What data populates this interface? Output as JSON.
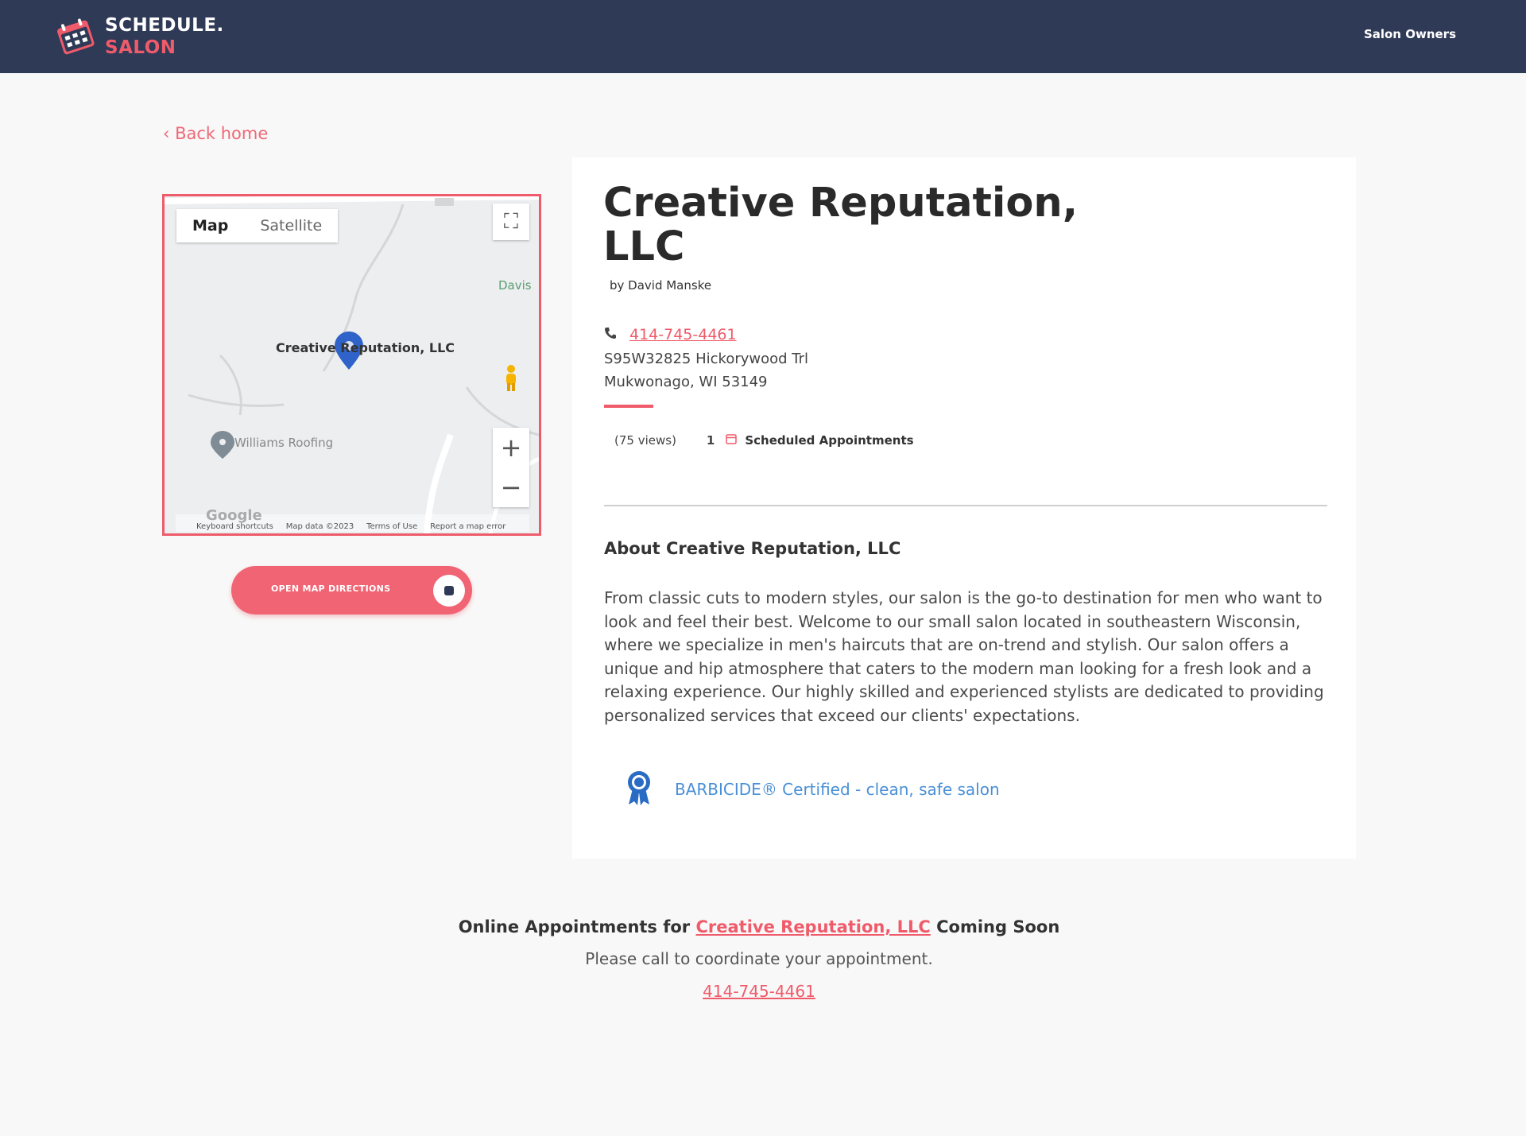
{
  "header": {
    "logo_line1": "SCHEDULE.",
    "logo_line2": "SALON",
    "owners_link": "Salon Owners"
  },
  "nav": {
    "back_link": "‹ Back home"
  },
  "map": {
    "tab_map": "Map",
    "tab_satellite": "Satellite",
    "marker_label": "Creative Reputation, LLC",
    "poi_label": "Williams Roofing",
    "place_label": "Davis",
    "zoom_in": "+",
    "zoom_out": "−",
    "google_label": "Google",
    "footer_shortcuts": "Keyboard shortcuts",
    "footer_data": "Map data ©2023",
    "footer_terms": "Terms of Use",
    "footer_report": "Report a map error"
  },
  "directions_button": {
    "label": "OPEN MAP DIRECTIONS"
  },
  "business": {
    "name": "Creative Reputation, LLC",
    "byline": "by David Manske",
    "phone": "414-745-4461",
    "address_line1": "S95W32825 Hickorywood Trl",
    "address_line2": "Mukwonago, WI 53149",
    "views": "(75 views)",
    "appointments_count": "1",
    "appointments_label": "Scheduled Appointments",
    "about_heading": "About Creative Reputation, LLC",
    "about_text": "From classic cuts to modern styles, our salon is the go-to destination for men who want to look and feel their best. Welcome to our small salon located in southeastern Wisconsin, where we specialize in men's haircuts that are on-trend and stylish. Our salon offers a unique and hip atmosphere that caters to the modern man looking for a fresh look and a relaxing experience. Our highly skilled and experienced stylists are dedicated to providing personalized services that exceed our clients' expectations.",
    "certification": "BARBICIDE® Certified - clean, safe salon"
  },
  "online": {
    "prefix": "Online Appointments for",
    "business_link": "Creative Reputation, LLC",
    "suffix": "Coming Soon",
    "call_text": "Please call to coordinate your appointment.",
    "phone": "414-745-4461"
  },
  "colors": {
    "accent": "#ef5b6a",
    "header_bg": "#2f3a57",
    "cert_blue": "#4a8fd6"
  }
}
